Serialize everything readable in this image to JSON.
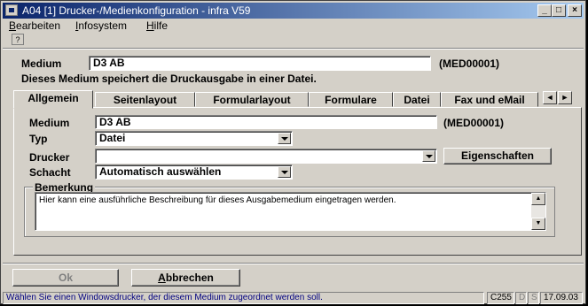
{
  "window": {
    "title": "A04 [1] Drucker-/Medienkonfiguration - infra V59",
    "minimize_glyph": "_",
    "maximize_glyph": "□",
    "close_glyph": "×"
  },
  "menu": {
    "items": [
      {
        "accel": "B",
        "rest": "earbeiten"
      },
      {
        "accel": "I",
        "rest": "nfosystem"
      },
      {
        "accel": "H",
        "rest": "ilfe"
      }
    ]
  },
  "toolbar": {
    "help_glyph": "?"
  },
  "header": {
    "medium_label": "Medium",
    "medium_value": "D3 AB",
    "medium_code": "(MED00001)",
    "description": "Dieses Medium speichert die Druckausgabe in einer Datei."
  },
  "tabs": [
    {
      "label": "Allgemein",
      "active": true
    },
    {
      "label": "Seitenlayout"
    },
    {
      "label": "Formularlayout"
    },
    {
      "label": "Formulare"
    },
    {
      "label": "Datei"
    },
    {
      "label": "Fax und eMail"
    }
  ],
  "tab_scroll": {
    "left": "◄",
    "right": "►"
  },
  "form": {
    "medium_label": "Medium",
    "medium_value": "D3 AB",
    "medium_code": "(MED00001)",
    "typ_label": "Typ",
    "typ_value": "Datei",
    "drucker_label": "Drucker",
    "drucker_value": "",
    "eigenschaften_button": "Eigenschaften",
    "schacht_label": "Schacht",
    "schacht_value": "Automatisch auswählen",
    "bemerkung_label": "Bemerkung",
    "bemerkung_text": "Hier kann eine ausführliche Beschreibung für dieses Ausgabemedium eingetragen werden."
  },
  "buttons": {
    "ok": "Ok",
    "cancel_accel": "A",
    "cancel_rest": "bbrechen"
  },
  "status": {
    "message": "Wählen Sie einen Windowsdrucker, der diesem Medium zugeordnet werden soll.",
    "code": "C255",
    "flag1": "D",
    "flag2": "S",
    "date": "17.09.03"
  },
  "colors": {
    "titlebar_start": "#0a246a",
    "titlebar_end": "#a6caf0",
    "face": "#d4d0c8",
    "status_text": "#000080"
  }
}
